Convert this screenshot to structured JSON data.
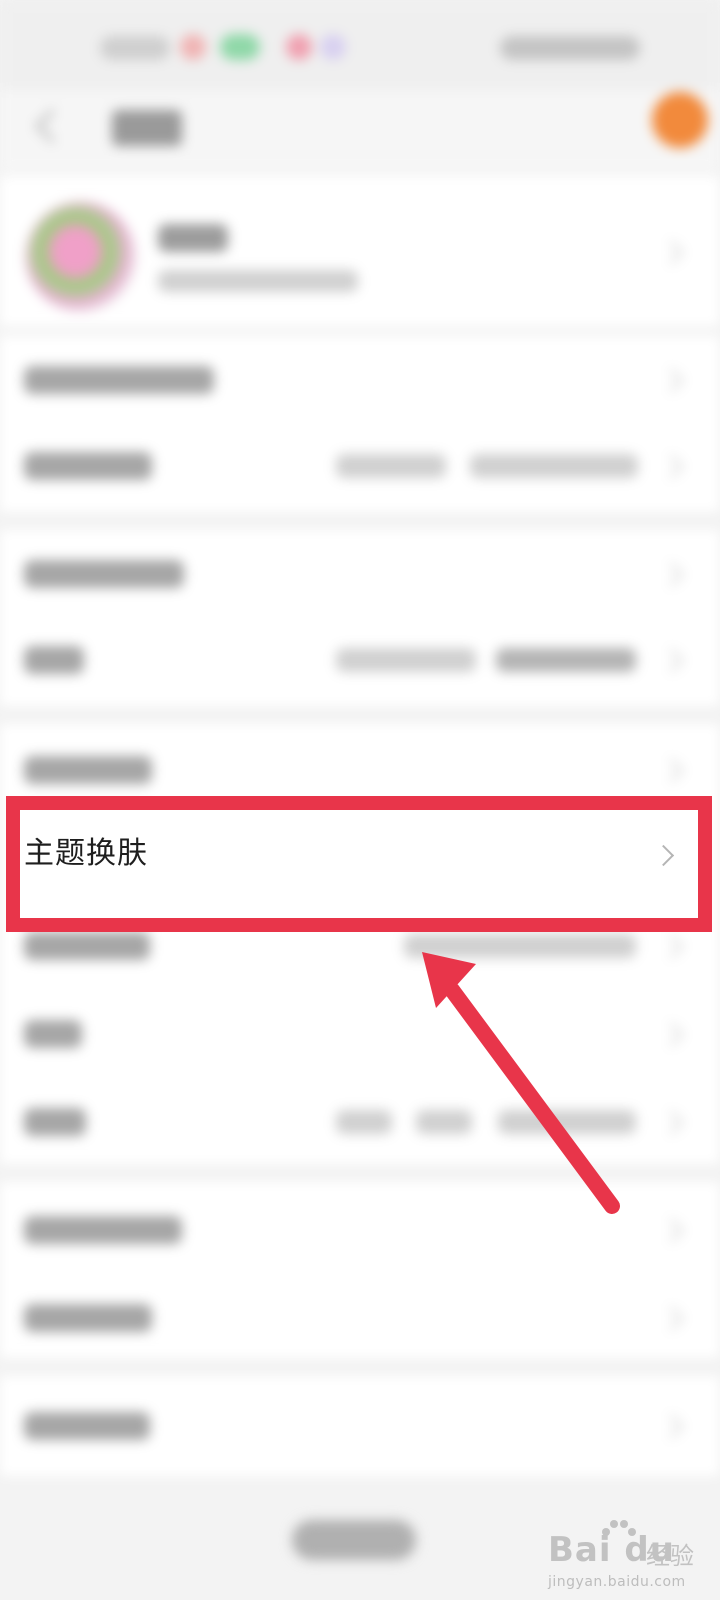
{
  "settings_list": {
    "highlighted_item": {
      "label": "主题换肤"
    }
  },
  "annotation": {
    "highlight_color": "#e8354a",
    "arrow_color": "#e8354a"
  },
  "watermark": {
    "brand": "Bai du",
    "product": "经验",
    "url": "jingyan.baidu.com"
  },
  "colors": {
    "accent_orange": "#f28a3c",
    "background": "#f3f3f3",
    "card": "#ffffff"
  }
}
